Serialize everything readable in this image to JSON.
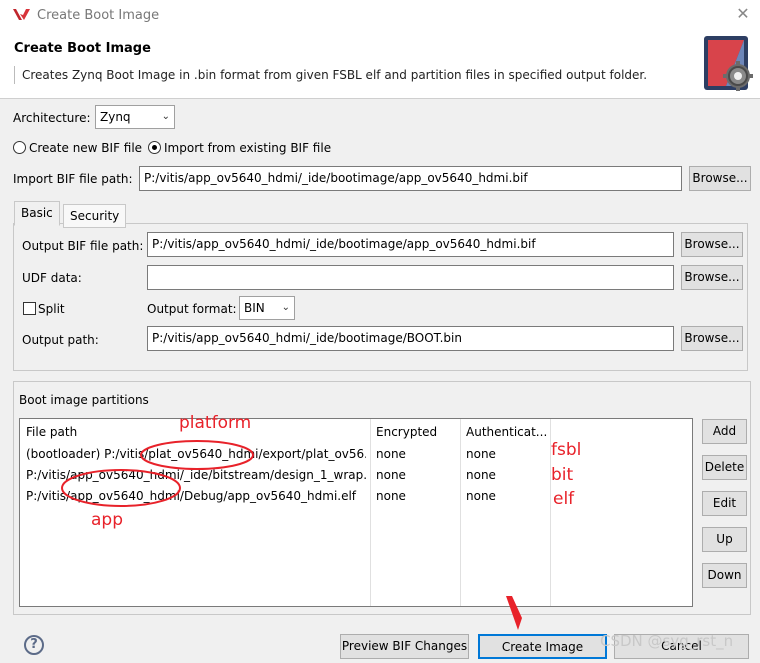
{
  "window": {
    "title": "Create Boot Image",
    "close_label": "✕"
  },
  "header": {
    "title": "Create Boot Image",
    "description": "Creates Zynq Boot Image in .bin format from given FSBL elf and partition files in specified output folder."
  },
  "architecture": {
    "label": "Architecture:",
    "value": "Zynq"
  },
  "bif_mode": {
    "create_label": "Create new BIF file",
    "import_label": "Import from existing BIF file",
    "selected": "import"
  },
  "import_bif": {
    "label": "Import BIF file path:",
    "value": "P:/vitis/app_ov5640_hdmi/_ide/bootimage/app_ov5640_hdmi.bif",
    "browse_label": "Browse..."
  },
  "tabs": [
    {
      "label": "Basic",
      "active": true
    },
    {
      "label": "Security",
      "active": false
    }
  ],
  "basic": {
    "output_bif": {
      "label": "Output BIF file path:",
      "value": "P:/vitis/app_ov5640_hdmi/_ide/bootimage/app_ov5640_hdmi.bif",
      "browse_label": "Browse..."
    },
    "udf": {
      "label": "UDF data:",
      "value": "",
      "browse_label": "Browse..."
    },
    "split": {
      "label": "Split",
      "checked": false
    },
    "output_format": {
      "label": "Output format:",
      "value": "BIN"
    },
    "output_path": {
      "label": "Output path:",
      "value": "P:/vitis/app_ov5640_hdmi/_ide/bootimage/BOOT.bin",
      "browse_label": "Browse..."
    }
  },
  "partitions": {
    "group_label": "Boot image partitions",
    "columns": [
      "File path",
      "Encrypted",
      "Authenticat..."
    ],
    "rows": [
      {
        "path": "(bootloader) P:/vitis/plat_ov5640_hdmi/export/plat_ov56...",
        "encrypted": "none",
        "authenticated": "none"
      },
      {
        "path": "P:/vitis/app_ov5640_hdmi/_ide/bitstream/design_1_wrap...",
        "encrypted": "none",
        "authenticated": "none"
      },
      {
        "path": "P:/vitis/app_ov5640_hdmi/Debug/app_ov5640_hdmi.elf",
        "encrypted": "none",
        "authenticated": "none"
      }
    ],
    "buttons": {
      "add": "Add",
      "delete": "Delete",
      "edit": "Edit",
      "up": "Up",
      "down": "Down"
    }
  },
  "annotations": {
    "platform": "platform",
    "app": "app",
    "fsbl": "fsbl",
    "bit": "bit",
    "elf": "elf",
    "color": "#e8222a"
  },
  "footer": {
    "help_label": "?",
    "preview_label": "Preview BIF Changes",
    "create_label": "Create Image",
    "cancel_label": "Cancel",
    "watermark": "CSDN @syg_rst_n"
  },
  "icons": {
    "app_logo": "vitis-logo-icon",
    "header_icon": "boot-image-gear-icon",
    "close": "close-icon"
  }
}
